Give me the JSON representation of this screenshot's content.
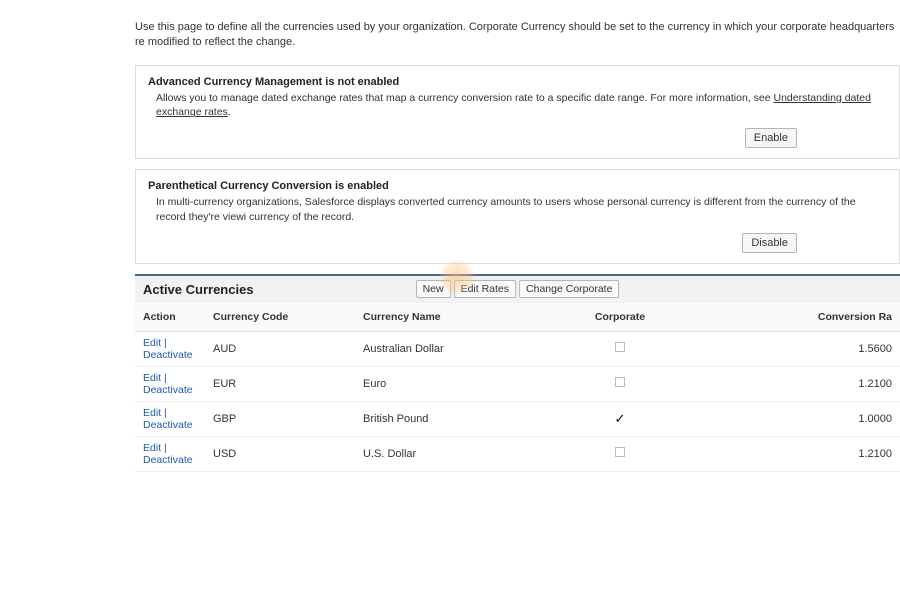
{
  "intro": "Use this page to define all the currencies used by your organization. Corporate Currency should be set to the currency in which your corporate headquarters re modified to reflect the change.",
  "panels": {
    "advanced": {
      "title": "Advanced Currency Management is not enabled",
      "body_prefix": "Allows you to manage dated exchange rates that map a currency conversion rate to a specific date range. For more information, see ",
      "link_text": "Understanding dated exchange rates",
      "button": "Enable"
    },
    "parenthetical": {
      "title": "Parenthetical Currency Conversion is enabled",
      "body": "In multi-currency organizations, Salesforce displays converted currency amounts to users whose personal currency is different from the currency of the record they're viewi currency of the record.",
      "button": "Disable"
    }
  },
  "section": {
    "title": "Active Currencies",
    "buttons": {
      "new": "New",
      "edit_rates": "Edit Rates",
      "change_corporate": "Change Corporate"
    }
  },
  "table": {
    "headers": {
      "action": "Action",
      "code": "Currency Code",
      "name": "Currency Name",
      "corporate": "Corporate",
      "rate": "Conversion Ra"
    },
    "action_labels": {
      "edit": "Edit",
      "deactivate": "Deactivate"
    },
    "rows": [
      {
        "code": "AUD",
        "name": "Australian Dollar",
        "corporate": false,
        "rate": "1.5600"
      },
      {
        "code": "EUR",
        "name": "Euro",
        "corporate": false,
        "rate": "1.2100"
      },
      {
        "code": "GBP",
        "name": "British Pound",
        "corporate": true,
        "rate": "1.0000"
      },
      {
        "code": "USD",
        "name": "U.S. Dollar",
        "corporate": false,
        "rate": "1.2100"
      }
    ]
  }
}
